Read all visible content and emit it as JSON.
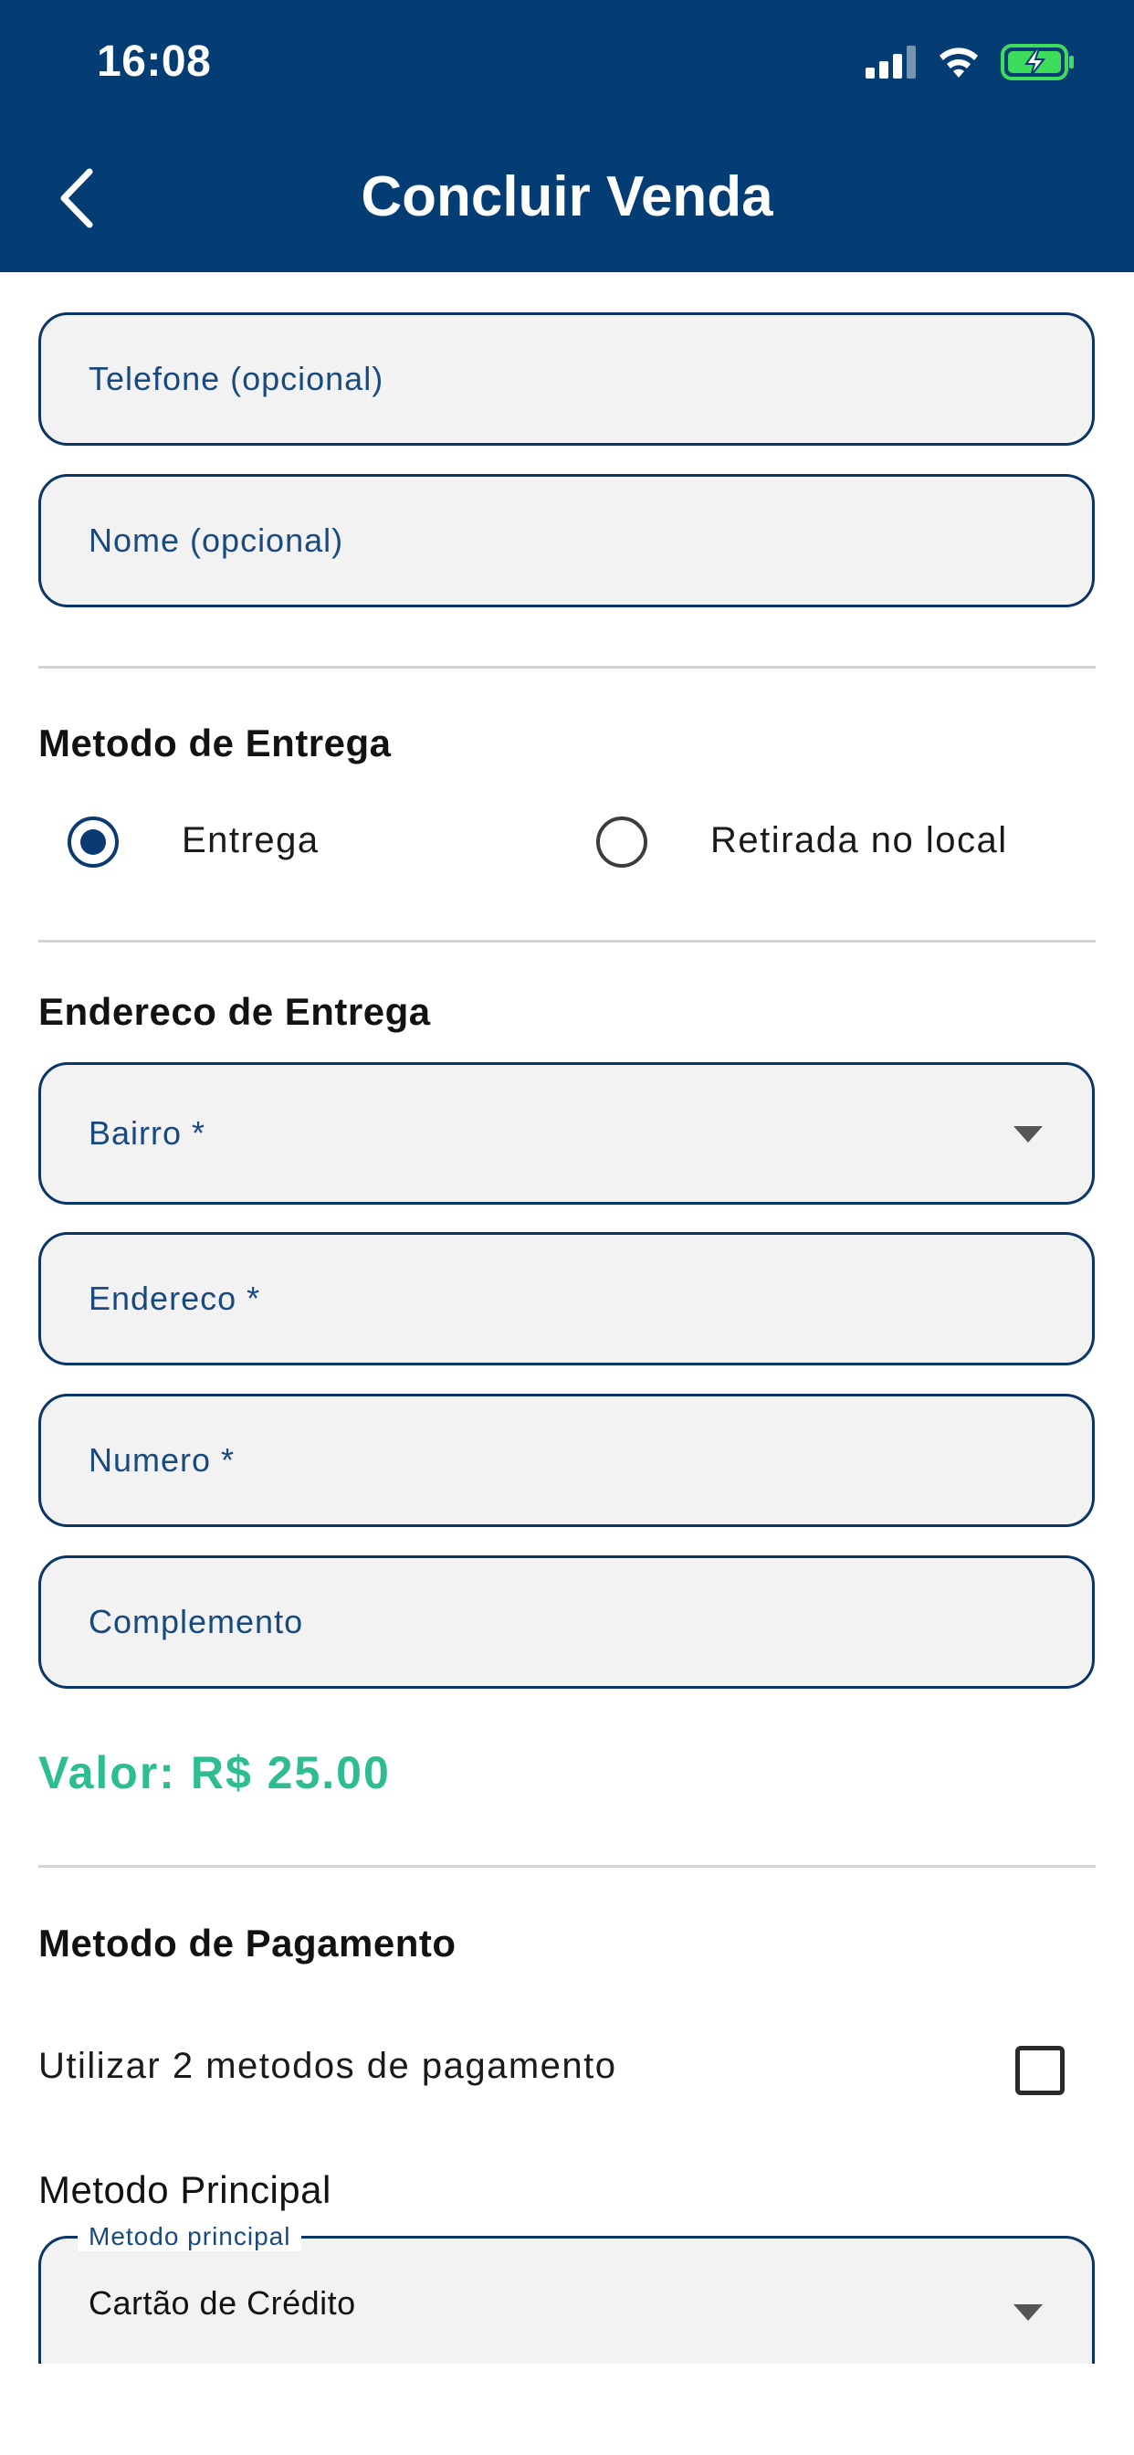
{
  "status_bar": {
    "time": "16:08"
  },
  "header": {
    "title": "Concluir Venda"
  },
  "contact": {
    "phone_label": "Telefone (opcional)",
    "name_label": "Nome (opcional)"
  },
  "delivery_method": {
    "title": "Metodo de Entrega",
    "options": [
      {
        "label": "Entrega",
        "selected": true
      },
      {
        "label": "Retirada no local",
        "selected": false
      }
    ]
  },
  "address": {
    "title": "Endereco de Entrega",
    "neighborhood_label": "Bairro *",
    "street_label": "Endereco *",
    "number_label": "Numero *",
    "complement_label": "Complemento"
  },
  "price": {
    "text": "Valor: R$ 25.00"
  },
  "payment": {
    "title": "Metodo de Pagamento",
    "two_methods_label": "Utilizar 2 metodos de pagamento",
    "two_methods_checked": false,
    "principal_title": "Metodo Principal",
    "principal_field_label": "Metodo principal",
    "principal_value": "Cartão de Crédito"
  },
  "colors": {
    "header_bg": "#043c74",
    "field_border": "#0b3566",
    "price": "#2ebc92",
    "battery_charging": "#3ddc5b"
  }
}
